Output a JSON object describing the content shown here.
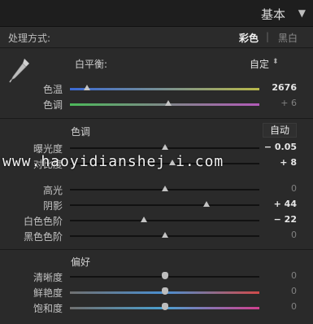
{
  "header": {
    "title": "基本",
    "collapse_icon": "triangle-down-icon"
  },
  "treatment": {
    "label": "处理方式:",
    "color": "彩色",
    "separator": "|",
    "bw": "黑白"
  },
  "white_balance": {
    "label": "白平衡:",
    "value": "自定",
    "dropper_icon": "eyedropper-icon",
    "sliders": [
      {
        "label": "色温",
        "value": "2676",
        "fraction": 0.09
      },
      {
        "label": "色调",
        "value": "+ 6",
        "fraction": 0.52
      }
    ]
  },
  "tone": {
    "title": "色调",
    "auto_label": "自动",
    "sliders": [
      {
        "label": "曝光度",
        "value": "− 0.05",
        "fraction": 0.5
      },
      {
        "label": "对比度",
        "value": "+ 8",
        "fraction": 0.54
      },
      {
        "label": "高光",
        "value": "0",
        "fraction": 0.5
      },
      {
        "label": "阴影",
        "value": "+ 44",
        "fraction": 0.72
      },
      {
        "label": "白色色阶",
        "value": "− 22",
        "fraction": 0.39
      },
      {
        "label": "黑色色阶",
        "value": "0",
        "fraction": 0.5
      }
    ]
  },
  "presence": {
    "title": "偏好",
    "sliders": [
      {
        "label": "清晰度",
        "value": "0",
        "fraction": 0.5
      },
      {
        "label": "鲜艳度",
        "value": "0",
        "fraction": 0.5
      },
      {
        "label": "饱和度",
        "value": "0",
        "fraction": 0.5
      }
    ]
  },
  "watermark": "www.haoyidianshej i.com",
  "colors": {
    "background": "#262626",
    "text": "#c8c8c8",
    "accent": "#ffffff"
  }
}
